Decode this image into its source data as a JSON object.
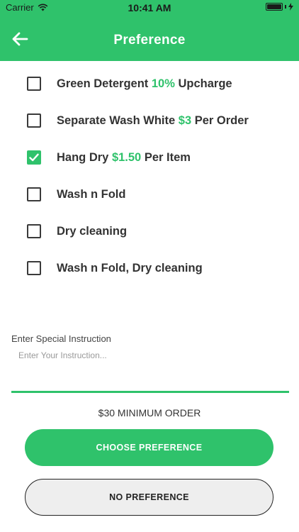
{
  "status_bar": {
    "carrier": "Carrier",
    "time": "10:41 AM"
  },
  "header": {
    "title": "Preference",
    "back_icon": "arrow-left-icon"
  },
  "options": [
    {
      "checked": false,
      "parts": [
        {
          "text": "Green Detergent "
        },
        {
          "text": "10%",
          "highlight": true
        },
        {
          "text": " Upcharge"
        }
      ]
    },
    {
      "checked": false,
      "parts": [
        {
          "text": "Separate Wash White "
        },
        {
          "text": "$3",
          "highlight": true
        },
        {
          "text": " Per Order"
        }
      ]
    },
    {
      "checked": true,
      "parts": [
        {
          "text": "Hang Dry "
        },
        {
          "text": "$1.50",
          "highlight": true
        },
        {
          "text": " Per Item"
        }
      ]
    },
    {
      "checked": false,
      "parts": [
        {
          "text": "Wash n Fold"
        }
      ]
    },
    {
      "checked": false,
      "parts": [
        {
          "text": "Dry cleaning"
        }
      ]
    },
    {
      "checked": false,
      "parts": [
        {
          "text": "Wash n Fold, Dry cleaning"
        }
      ]
    }
  ],
  "instruction": {
    "label": "Enter Special Instruction",
    "placeholder": "Enter Your Instruction...",
    "value": ""
  },
  "minimum_order": "$30 MINIMUM ORDER",
  "buttons": {
    "choose": "CHOOSE PREFERENCE",
    "none": "NO PREFERENCE"
  },
  "colors": {
    "accent": "#2fc26b",
    "text": "#333333"
  }
}
